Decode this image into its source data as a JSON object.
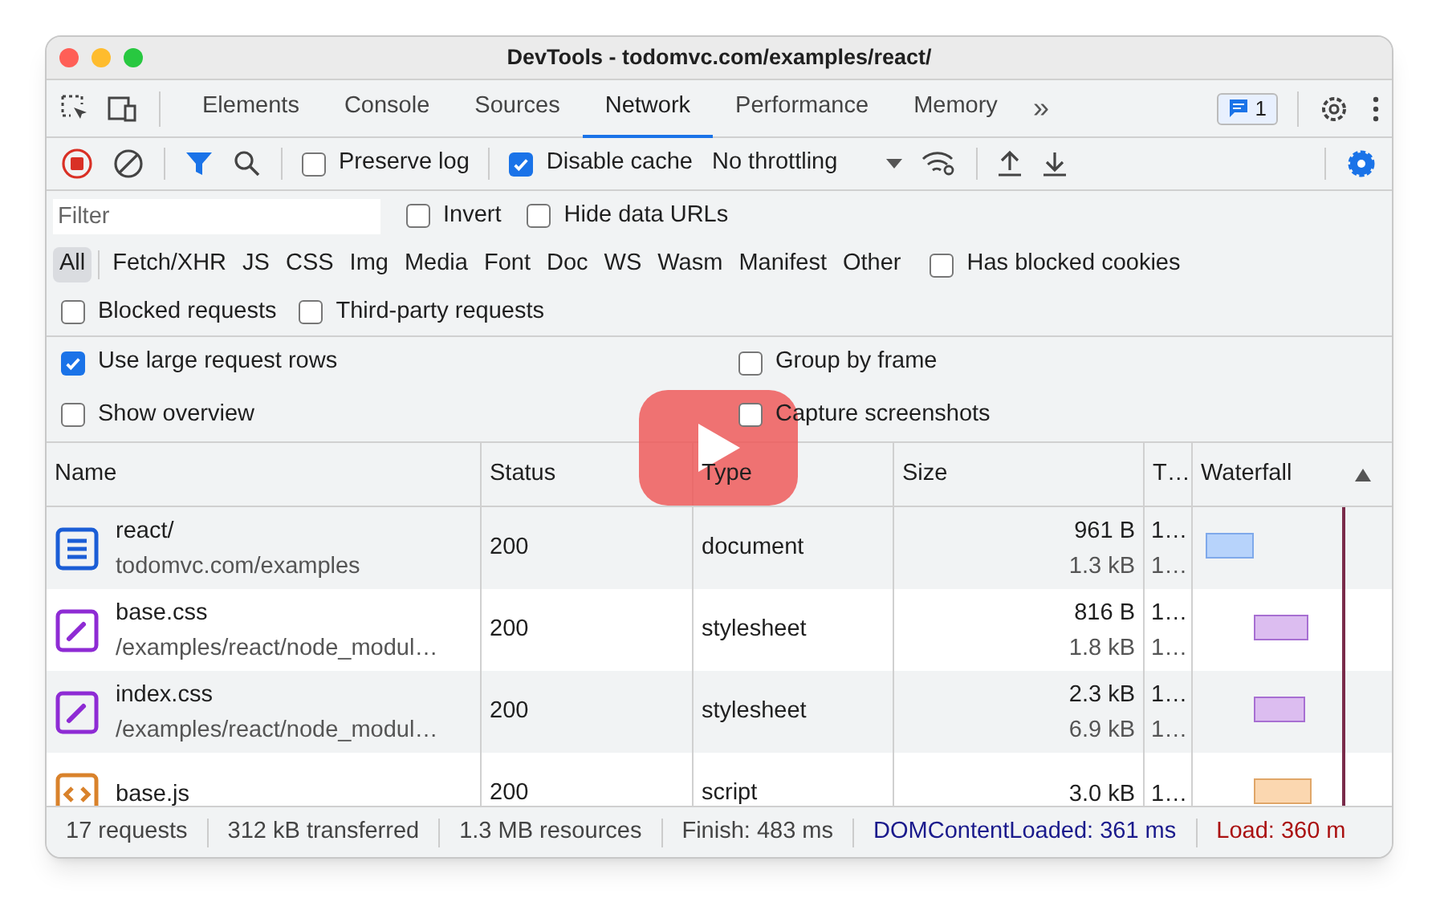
{
  "window": {
    "title": "DevTools - todomvc.com/examples/react/"
  },
  "tabs": [
    {
      "label": "Elements",
      "selected": false
    },
    {
      "label": "Console",
      "selected": false
    },
    {
      "label": "Sources",
      "selected": false
    },
    {
      "label": "Network",
      "selected": true
    },
    {
      "label": "Performance",
      "selected": false
    },
    {
      "label": "Memory",
      "selected": false
    }
  ],
  "more_tabs": "»",
  "issues_badge": "1",
  "toolbar": {
    "preserve_log": {
      "label": "Preserve log",
      "checked": false
    },
    "disable_cache": {
      "label": "Disable cache",
      "checked": true
    },
    "throttling": "No throttling"
  },
  "filter": {
    "placeholder": "Filter",
    "options": [
      {
        "label": "Invert",
        "checked": false
      },
      {
        "label": "Hide data URLs",
        "checked": false
      }
    ]
  },
  "type_filters": [
    {
      "label": "All",
      "selected": true
    },
    {
      "label": "Fetch/XHR",
      "selected": false
    },
    {
      "label": "JS",
      "selected": false
    },
    {
      "label": "CSS",
      "selected": false
    },
    {
      "label": "Img",
      "selected": false
    },
    {
      "label": "Media",
      "selected": false
    },
    {
      "label": "Font",
      "selected": false
    },
    {
      "label": "Doc",
      "selected": false
    },
    {
      "label": "WS",
      "selected": false
    },
    {
      "label": "Wasm",
      "selected": false
    },
    {
      "label": "Manifest",
      "selected": false
    },
    {
      "label": "Other",
      "selected": false
    }
  ],
  "has_blocked_cookies": {
    "label": "Has blocked cookies",
    "checked": false
  },
  "request_options": [
    {
      "label": "Blocked requests",
      "checked": false
    },
    {
      "label": "Third-party requests",
      "checked": false
    }
  ],
  "settings": [
    {
      "label": "Use large request rows",
      "checked": true
    },
    {
      "label": "Group by frame",
      "checked": false
    },
    {
      "label": "Show overview",
      "checked": false
    },
    {
      "label": "Capture screenshots",
      "checked": false
    }
  ],
  "table": {
    "columns": [
      "Name",
      "Status",
      "Type",
      "Size",
      "T…",
      "Waterfall"
    ],
    "rows": [
      {
        "kind": "document",
        "name": "react/",
        "path": "todomvc.com/examples",
        "status": "200",
        "type": "document",
        "size": "961 B",
        "resource": "1.3 kB",
        "time": "1…",
        "latency": "1…"
      },
      {
        "kind": "stylesheet",
        "name": "base.css",
        "path": "/examples/react/node_modul…",
        "status": "200",
        "type": "stylesheet",
        "size": "816 B",
        "resource": "1.8 kB",
        "time": "1…",
        "latency": "1…"
      },
      {
        "kind": "stylesheet",
        "name": "index.css",
        "path": "/examples/react/node_modul…",
        "status": "200",
        "type": "stylesheet",
        "size": "2.3 kB",
        "resource": "6.9 kB",
        "time": "1…",
        "latency": "1…"
      },
      {
        "kind": "script",
        "name": "base.js",
        "status": "200",
        "type": "script",
        "size": "3.0 kB",
        "time": "1…"
      }
    ]
  },
  "status_bar": [
    {
      "kind": "plain",
      "text": "17 requests"
    },
    {
      "kind": "plain",
      "text": "312 kB transferred"
    },
    {
      "kind": "plain",
      "text": "1.3 MB resources"
    },
    {
      "kind": "plain",
      "text": "Finish: 483 ms"
    },
    {
      "kind": "dom",
      "text": "DOMContentLoaded: 361 ms"
    },
    {
      "kind": "load",
      "text": "Load: 360 m"
    }
  ]
}
